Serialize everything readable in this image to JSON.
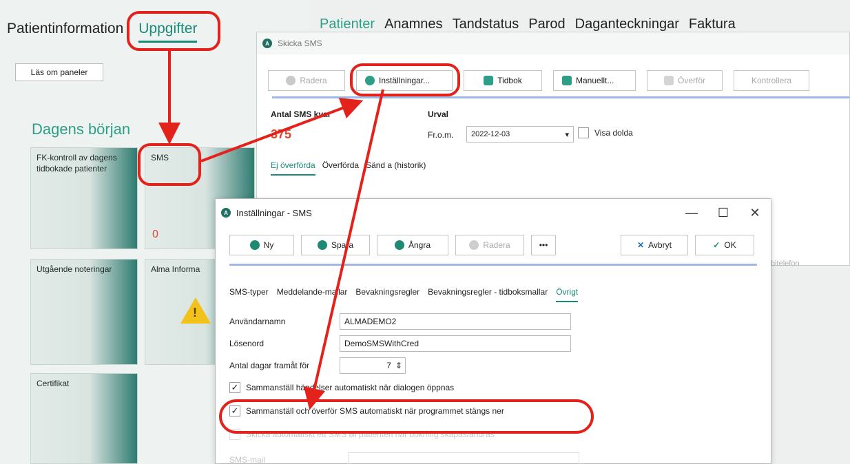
{
  "left": {
    "tabs": [
      "Patientinformation",
      "Uppgifter"
    ],
    "las_button": "Läs om paneler",
    "dagens_title": "Dagens början",
    "tiles": {
      "fk": "FK-kontroll av dagens tidbokade patienter",
      "sms": "SMS",
      "sms_count": "0",
      "utg": "Utgående noteringar",
      "alma": "Alma Informa",
      "cert": "Certifikat"
    },
    "warn_glyph": "!"
  },
  "top_tabs": [
    "Patienter",
    "Anamnes",
    "Tandstatus",
    "Parod",
    "Daganteckningar",
    "Faktura"
  ],
  "skicka": {
    "title": "Skicka SMS",
    "app_glyph": "A",
    "toolbar": {
      "radera": "Radera",
      "installningar": "Inställningar...",
      "tidbok": "Tidbok",
      "manuellt": "Manuellt...",
      "overfor": "Överför",
      "kontrollera": "Kontrollera"
    },
    "count_label": "Antal SMS kvar",
    "count_value": "375",
    "urval_label": "Urval",
    "from_label": "Fr.o.m.",
    "from_value": "2022-12-03",
    "dropdown_glyph": "▾",
    "visa_dolda": "Visa dolda",
    "subtabs": [
      "Ej överförda",
      "Överförda",
      "Sänd a (historik)"
    ],
    "column_fragment": "bitelefon"
  },
  "inst": {
    "title": "Inställningar - SMS",
    "controls": {
      "min": "—",
      "max": "☐",
      "close": "✕"
    },
    "toolbar": {
      "ny": "Ny",
      "spara": "Spara",
      "angra": "Ångra",
      "radera": "Radera",
      "more": "•••"
    },
    "avbryt": "Avbryt",
    "ok": "OK",
    "avbryt_glyph": "✕",
    "ok_glyph": "✓",
    "tabs": [
      "SMS-typer",
      "Meddelande-mallar",
      "Bevakningsregler",
      "Bevakningsregler - tidboksmallar",
      "Övrigt"
    ],
    "anvandarnamn_label": "Användarnamn",
    "anvandarnamn_value": "ALMADEMO2",
    "losenord_label": "Lösenord",
    "losenord_value": "DemoSMSWithCred",
    "dagar_label": "Antal dagar framåt för",
    "dagar_value": "7",
    "stepper_glyph": "⇕",
    "check_glyph": "✓",
    "cb1_label": "Sammanställ händelser automatiskt när dialogen öppnas",
    "cb2_label": "Sammanställ och överför SMS automatiskt när programmet stängs ner",
    "cb3_label": "Skicka automatiskt ett SMS till patienten när bokning skapas/ändras",
    "sms_mail_label": "SMS-mail"
  },
  "colors": {
    "accent": "#1a8a78",
    "annotation": "#e3231b",
    "count": "#e0492e",
    "bar": "#9fb7e5"
  }
}
